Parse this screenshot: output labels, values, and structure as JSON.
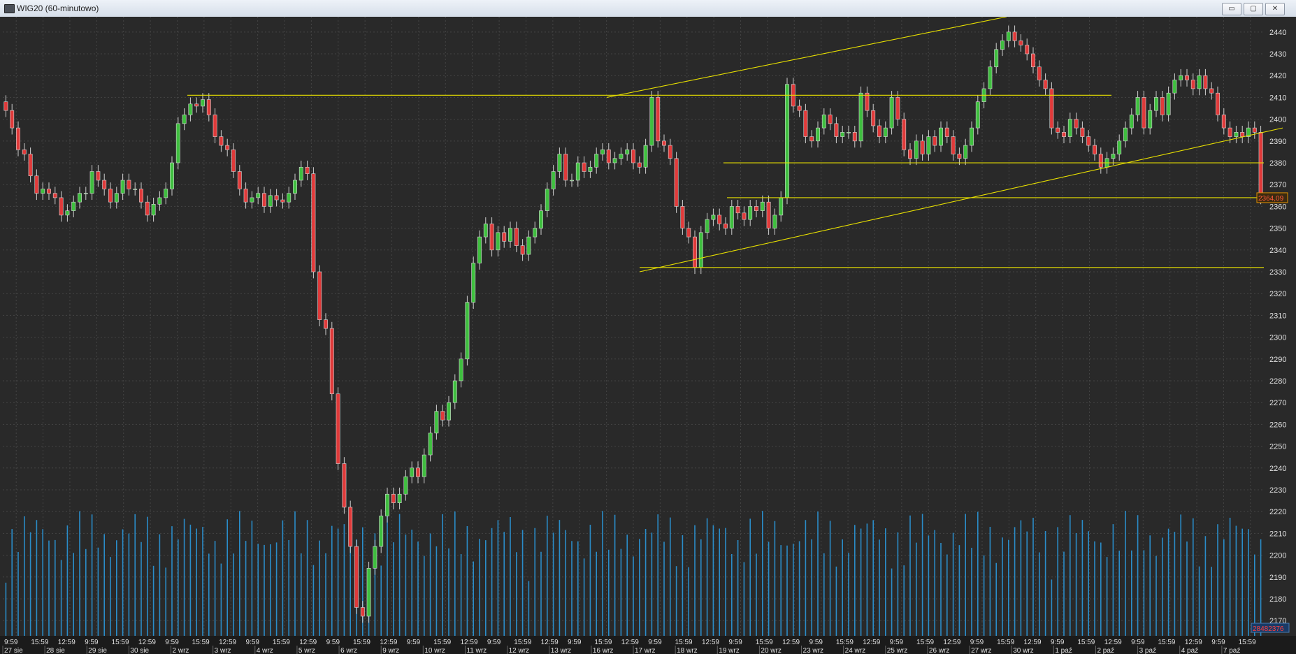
{
  "window": {
    "title": "WIG20 (60-minutowo)",
    "minimize": "▭",
    "maximize": "▢",
    "close": "✕"
  },
  "colors": {
    "background": "#292929",
    "grid": "#444444",
    "up": "#3fbf3f",
    "down": "#e03a3a",
    "volume": "#2a8cc8",
    "lines": "#e8e000",
    "label": "#e0e0e0"
  },
  "chart_data": {
    "type": "candlestick",
    "instrument": "WIG20",
    "interval": "60-minutowo",
    "ylim": [
      2163,
      2447
    ],
    "y_ticks": [
      2170,
      2180,
      2190,
      2200,
      2210,
      2220,
      2230,
      2240,
      2250,
      2260,
      2270,
      2280,
      2290,
      2300,
      2310,
      2320,
      2330,
      2340,
      2350,
      2360,
      2370,
      2380,
      2390,
      2400,
      2410,
      2420,
      2430,
      2440
    ],
    "x_time_labels": [
      "9:59",
      "15:59",
      "12:59",
      "9:59",
      "15:59",
      "12:59",
      "9:59",
      "15:59",
      "12:59",
      "9:59",
      "15:59",
      "12:59",
      "9:59",
      "15:59",
      "12:59",
      "9:59",
      "15:59",
      "12:59",
      "9:59",
      "15:59",
      "12:59",
      "9:59",
      "15:59",
      "12:59",
      "9:59",
      "15:59",
      "12:59",
      "9:59",
      "15:59",
      "12:59",
      "9:59",
      "15:59",
      "12:59",
      "9:59",
      "15:59",
      "12:59",
      "9:59",
      "15:59",
      "12:59",
      "9:59",
      "15:59",
      "12:59",
      "9:59",
      "15:59",
      "12:59",
      "9:59",
      "15:59"
    ],
    "x_date_labels": [
      "27 sie",
      "28 sie",
      "29 sie",
      "30 sie",
      "2 wrz",
      "3 wrz",
      "4 wrz",
      "5 wrz",
      "6 wrz",
      "9 wrz",
      "10 wrz",
      "11 wrz",
      "12 wrz",
      "13 wrz",
      "16 wrz",
      "17 wrz",
      "18 wrz",
      "19 wrz",
      "20 wrz",
      "23 wrz",
      "24 wrz",
      "25 wrz",
      "26 wrz",
      "27 wrz",
      "30 wrz",
      "1 paź",
      "2 paź",
      "3 paź",
      "4 paź",
      "7 paź"
    ],
    "candle_closes": [
      2404,
      2396,
      2386,
      2384,
      2374,
      2366,
      2368,
      2366,
      2364,
      2356,
      2358,
      2362,
      2366,
      2366,
      2376,
      2372,
      2368,
      2362,
      2366,
      2372,
      2368,
      2368,
      2362,
      2356,
      2361,
      2364,
      2368,
      2380,
      2398,
      2402,
      2407,
      2406,
      2409,
      2402,
      2392,
      2388,
      2386,
      2376,
      2368,
      2362,
      2364,
      2366,
      2360,
      2365,
      2363,
      2362,
      2366,
      2372,
      2378,
      2375,
      2330,
      2308,
      2304,
      2274,
      2242,
      2222,
      2204,
      2176,
      2172,
      2194,
      2204,
      2218,
      2228,
      2224,
      2228,
      2236,
      2240,
      2236,
      2246,
      2256,
      2266,
      2262,
      2270,
      2280,
      2290,
      2316,
      2334,
      2346,
      2352,
      2340,
      2348,
      2344,
      2350,
      2342,
      2338,
      2346,
      2350,
      2358,
      2368,
      2376,
      2384,
      2372,
      2372,
      2380,
      2376,
      2378,
      2384,
      2386,
      2380,
      2382,
      2384,
      2386,
      2380,
      2378,
      2388,
      2410,
      2390,
      2388,
      2382,
      2360,
      2350,
      2346,
      2332,
      2348,
      2354,
      2356,
      2352,
      2350,
      2360,
      2357,
      2354,
      2360,
      2358,
      2362,
      2350,
      2356,
      2364,
      2416,
      2406,
      2404,
      2392,
      2390,
      2396,
      2402,
      2398,
      2392,
      2394,
      2394,
      2390,
      2412,
      2404,
      2397,
      2392,
      2396,
      2410,
      2400,
      2386,
      2382,
      2390,
      2384,
      2392,
      2388,
      2396,
      2392,
      2384,
      2382,
      2388,
      2396,
      2408,
      2414,
      2424,
      2432,
      2436,
      2440,
      2436,
      2434,
      2430,
      2424,
      2418,
      2414,
      2396,
      2394,
      2392,
      2400,
      2396,
      2392,
      2388,
      2384,
      2378,
      2382,
      2384,
      2390,
      2396,
      2402,
      2410,
      2396,
      2404,
      2410,
      2402,
      2412,
      2418,
      2420,
      2418,
      2414,
      2420,
      2414,
      2412,
      2402,
      2396,
      2392,
      2394,
      2392,
      2396,
      2394,
      2364
    ],
    "last_price": "2364,09",
    "last_volume": "28482376",
    "volume_max": 20000000
  }
}
